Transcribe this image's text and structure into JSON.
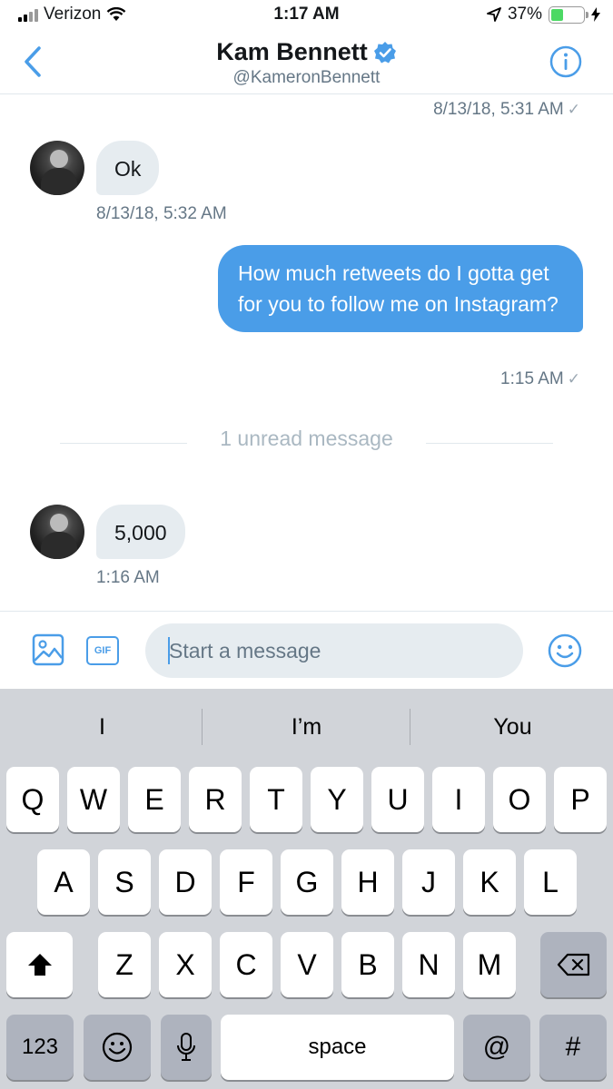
{
  "status_bar": {
    "carrier": "Verizon",
    "time": "1:17 AM",
    "battery_percent": "37%",
    "battery_level": 0.37
  },
  "header": {
    "name": "Kam Bennett",
    "handle": "@KameronBennett",
    "verified": true
  },
  "conversation": {
    "top_timestamp": "8/13/18, 5:31 AM",
    "messages": [
      {
        "from": "them",
        "text": "Ok",
        "time": "8/13/18, 5:32 AM"
      },
      {
        "from": "me",
        "text": "How much retweets do I gotta get for you to follow me on Instagram?",
        "time": "1:15 AM"
      },
      {
        "from": "them",
        "text": "5,000",
        "time": "1:16 AM"
      }
    ],
    "unread_divider": "1 unread message"
  },
  "composer": {
    "placeholder": "Start a message",
    "gif_label": "GIF"
  },
  "keyboard": {
    "suggestions": [
      "I",
      "I’m",
      "You"
    ],
    "row1": [
      "Q",
      "W",
      "E",
      "R",
      "T",
      "Y",
      "U",
      "I",
      "O",
      "P"
    ],
    "row2": [
      "A",
      "S",
      "D",
      "F",
      "G",
      "H",
      "J",
      "K",
      "L"
    ],
    "row3": [
      "Z",
      "X",
      "C",
      "V",
      "B",
      "N",
      "M"
    ],
    "numbers_label": "123",
    "space_label": "space",
    "at_label": "@",
    "hash_label": "#"
  },
  "colors": {
    "accent": "#4a9de8",
    "bubble_in": "#e6ecf0",
    "muted_text": "#657786",
    "keyboard_bg": "#d1d4d9"
  },
  "icons": [
    "back-chevron-icon",
    "verified-badge-icon",
    "info-icon",
    "image-icon",
    "gif-icon",
    "emoji-icon",
    "shift-icon",
    "backspace-icon",
    "keyboard-emoji-icon",
    "microphone-icon",
    "location-arrow-icon",
    "wifi-icon",
    "charging-bolt-icon"
  ]
}
